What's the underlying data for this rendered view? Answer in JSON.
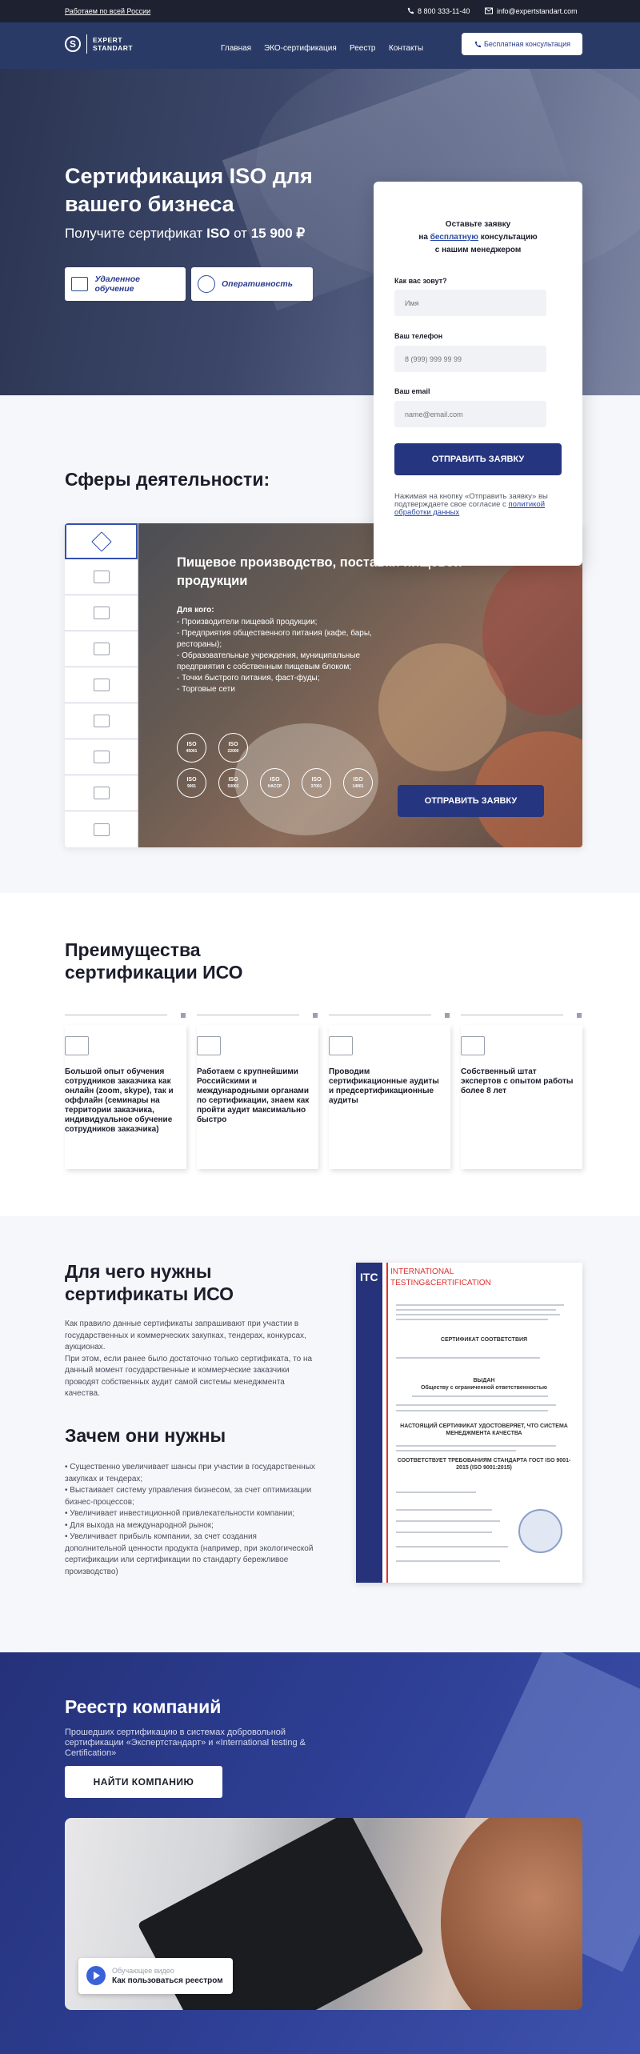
{
  "topbar": {
    "region_link": "Работаем по всей России",
    "phone": "8 800 333-11-40",
    "email": "info@expertstandart.com"
  },
  "header": {
    "logo_line1": "EXPERT",
    "logo_line2": "STANDART",
    "nav": [
      "Главная",
      "ЭКО-сертификация",
      "Реестр",
      "Контакты"
    ],
    "cta": "Бесплатная консультация"
  },
  "hero": {
    "title": "Сертификация ISO для вашего бизнеса",
    "subtitle_prefix": "Получите сертификат",
    "subtitle_iso": "ISO",
    "subtitle_mid": "от",
    "subtitle_price": "15 900 ₽",
    "btn_remote": "Удаленное обучение",
    "btn_speed": "Оперативность"
  },
  "form": {
    "title_line1": "Оставьте заявку",
    "title_pre": "на",
    "title_hl": "бесплатную",
    "title_post": "консультацию",
    "title_line3": "с нашим менеджером",
    "name_label": "Как вас зовут?",
    "name_placeholder": "Имя",
    "phone_label": "Ваш телефон",
    "phone_placeholder": "8 (999) 999 99 99",
    "email_label": "Ваш email",
    "email_placeholder": "name@email.com",
    "submit": "ОТПРАВИТЬ ЗАЯВКУ",
    "agree_text": "Нажимая на кнопку «Отправить заявку» вы подтверждаете свое согласие с",
    "agree_link": "политикой обработки данных"
  },
  "spheres": {
    "heading": "Сферы деятельности:",
    "tab_icons": [
      "tools-icon",
      "factory-icon",
      "construction-icon",
      "gears-icon",
      "document-icon",
      "bricks-icon",
      "crane-icon",
      "delivery-icon",
      "checklist-icon"
    ],
    "active_title": "Пищевое производство, поставки пищевой продукции",
    "for_who": "Для кого:",
    "items": [
      "- Производители пищевой продукции;",
      "- Предприятия общественного питания (кафе, бары, рестораны);",
      "- Образовательные учреждения, муниципальные предприятия с собственным пищевым блоком;",
      "- Точки быстрого питания, фаст-фуды;",
      "- Торговые сети"
    ],
    "iso_badges": [
      {
        "top": "ISO",
        "num": "45001"
      },
      {
        "top": "ISO",
        "num": "22000"
      },
      {
        "top": "ISO",
        "num": "9001"
      },
      {
        "top": "ISO",
        "num": "50001"
      },
      {
        "top": "ISO",
        "num": "HACCP"
      },
      {
        "top": "ISO",
        "num": "37001"
      },
      {
        "top": "ISO",
        "num": "14001"
      }
    ],
    "submit": "ОТПРАВИТЬ ЗАЯВКУ"
  },
  "advantages": {
    "heading": "Преимущества сертификации ИСО",
    "cards": [
      {
        "icon": "monitor-icon",
        "text": "Большой опыт обучения сотрудников заказчика как онлайн (zoom, skype), так и оффлайн (семинары на территории заказчика, индивидуальное обучение сотрудников заказчика)"
      },
      {
        "icon": "certificate-icon",
        "text": "Работаем с крупнейшими Российскими и международными органами по сертификации, знаем как пройти аудит максимально быстро"
      },
      {
        "icon": "audit-icon",
        "text": "Проводим сертификационные аудиты и предсертификационные аудиты"
      },
      {
        "icon": "team-icon",
        "text": "Собственный штат экспертов с опытом работы более 8 лет"
      }
    ]
  },
  "why": {
    "heading": "Для чего нужны сертификаты ИСО",
    "text": "Как правило данные сертификаты запрашивают при участии в государственных и коммерческих закупках, тендерах, конкурсах, аукционах.\nПри этом, если ранее было достаточно только сертификата, то на данный момент государственные и коммерческие заказчики проводят собственных аудит самой системы менеджмента качества.",
    "heading2": "Зачем они нужны",
    "items": [
      "• Существенно увеличивает шансы при участии в государственных закупках и тендерах;",
      "• Выстаивает систему управления бизнесом, за счет оптимизации бизнес-процессов;",
      "• Увеличивает инвестиционной привлекательности компании;",
      "• Для выхода на международной рынок;",
      "• Увеличивает прибыль компании, за счет создания дополнительной ценности продукта (например, при экологической сертификации или сертификации по стандарту бережливое производство)"
    ],
    "cert": {
      "itc": "ITC",
      "org_line1": "INTERNATIONAL",
      "org_line2": "TESTING&CERTIFICATION",
      "doc_title": "СЕРТИФИКАТ СООТВЕТСТВИЯ",
      "issued": "ВЫДАН",
      "company": "Обществу с ограниченной ответственностью",
      "confirm": "НАСТОЯЩИЙ СЕРТИФИКАТ УДОСТОВЕРЯЕТ, ЧТО СИСТЕМА МЕНЕДЖМЕНТА КАЧЕСТВА",
      "standard": "СООТВЕТСТВУЕТ ТРЕБОВАНИЯМ СТАНДАРТА ГОСТ ISO 9001-2015 (ISO 9001:2015)"
    }
  },
  "registry": {
    "heading": "Реестр компаний",
    "subtitle": "Прошедших сертификацию в системах добровольной сертификации «Экспертстандарт» и «International testing & Certification»",
    "button": "НАЙТИ КОМПАНИЮ",
    "video_label": "Обучающее видео",
    "video_title": "Как пользоваться реестром"
  },
  "colors": {
    "primary": "#26357f",
    "header_bg": "#2a3a66",
    "topbar_bg": "#1e2230",
    "link": "#2a4aa8"
  }
}
